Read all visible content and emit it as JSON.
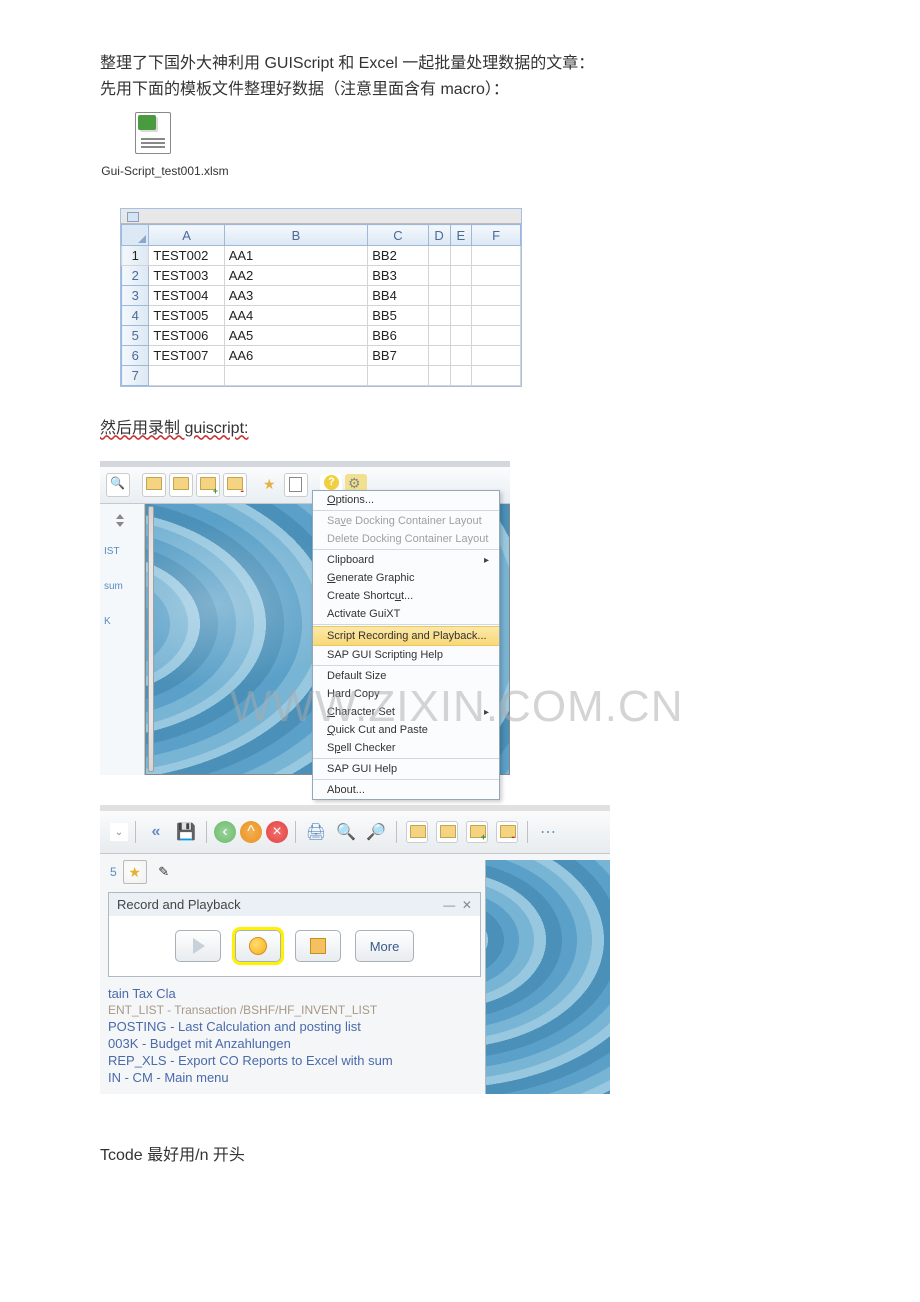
{
  "intro": {
    "line1": "整理了下国外大神利用 GUIScript 和 Excel 一起批量处理数据的文章：",
    "line2": "先用下面的模板文件整理好数据（注意里面含有 macro）："
  },
  "file": {
    "name": "Gui-Script_test001.xlsm"
  },
  "excel": {
    "title_fragment": "",
    "columns": [
      "A",
      "B",
      "C",
      "D",
      "E",
      "F"
    ],
    "rows": [
      {
        "n": "1",
        "a": "TEST002",
        "b": "AA1",
        "c": "BB2"
      },
      {
        "n": "2",
        "a": "TEST003",
        "b": "AA2",
        "c": "BB3"
      },
      {
        "n": "3",
        "a": "TEST004",
        "b": "AA3",
        "c": "BB4"
      },
      {
        "n": "4",
        "a": "TEST005",
        "b": "AA4",
        "c": "BB5"
      },
      {
        "n": "5",
        "a": "TEST006",
        "b": "AA5",
        "c": "BB6"
      },
      {
        "n": "6",
        "a": "TEST007",
        "b": "AA6",
        "c": "BB7"
      },
      {
        "n": "7",
        "a": "",
        "b": "",
        "c": ""
      }
    ]
  },
  "mid_text": "然后用录制 guiscript:",
  "sap": {
    "left_labels": [
      "IST",
      "sum",
      "K"
    ],
    "menu": [
      {
        "label": "Options...",
        "underline": "O",
        "type": "item"
      },
      {
        "type": "sep"
      },
      {
        "label": "Save Docking Container Layout",
        "underline": "v",
        "disabled": true,
        "type": "item"
      },
      {
        "label": "Delete Docking Container Layout",
        "disabled": true,
        "type": "item"
      },
      {
        "type": "sep"
      },
      {
        "label": "Clipboard",
        "submenu": true,
        "type": "item"
      },
      {
        "label": "Generate Graphic",
        "underline": "G",
        "type": "item"
      },
      {
        "label": "Create Shortcut...",
        "underline": "u",
        "type": "item"
      },
      {
        "label": "Activate GuiXT",
        "type": "item"
      },
      {
        "type": "sep"
      },
      {
        "label": "Script Recording and Playback...",
        "highlight": true,
        "type": "item"
      },
      {
        "label": "SAP GUI Scripting Help",
        "type": "item"
      },
      {
        "type": "sep"
      },
      {
        "label": "Default Size",
        "type": "item"
      },
      {
        "label": "Hard Copy",
        "type": "item"
      },
      {
        "label": "Character Set",
        "underline": "C",
        "submenu": true,
        "type": "item"
      },
      {
        "label": "Quick Cut and Paste",
        "underline": "Q",
        "type": "item"
      },
      {
        "label": "Spell Checker",
        "underline": "p",
        "type": "item"
      },
      {
        "type": "sep"
      },
      {
        "label": "SAP GUI Help",
        "type": "item"
      },
      {
        "type": "sep"
      },
      {
        "label": "About...",
        "type": "item"
      }
    ]
  },
  "record": {
    "dialog_title": "Record and Playback",
    "more": "More",
    "lines": [
      {
        "text": "tain Tax Cla",
        "cls": "rec-line"
      },
      {
        "text": "ENT_LIST - Transaction /BSHF/HF_INVENT_LIST",
        "cls": "rec-line faded"
      },
      {
        "text": "POSTING - Last Calculation and posting list",
        "cls": "rec-line"
      },
      {
        "text": "003K - Budget mit Anzahlungen",
        "cls": "rec-line"
      },
      {
        "text": "REP_XLS - Export CO Reports to Excel with sum",
        "cls": "rec-line"
      },
      {
        "text": "IN - CM - Main menu",
        "cls": "rec-line"
      }
    ]
  },
  "tail": "Tcode 最好用/n 开头",
  "watermark": "WWW.ZIXIN.COM.CN"
}
